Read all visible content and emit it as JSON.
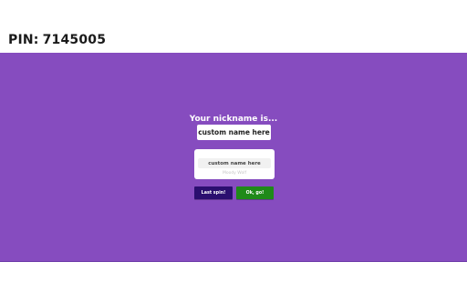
{
  "header": {
    "pin_label": "PIN:",
    "pin_value": "7145005"
  },
  "colors": {
    "background": "#864cbf",
    "last_spin_button": "#2b0f6f",
    "ok_button": "#1f8a19"
  },
  "nickname": {
    "title": "Your nickname is...",
    "value": "custom name here"
  },
  "custom_input": {
    "value": "custom name here",
    "hint": "Moody Wolf"
  },
  "buttons": {
    "last_spin": "Last spin!",
    "ok": "Ok, go!"
  }
}
